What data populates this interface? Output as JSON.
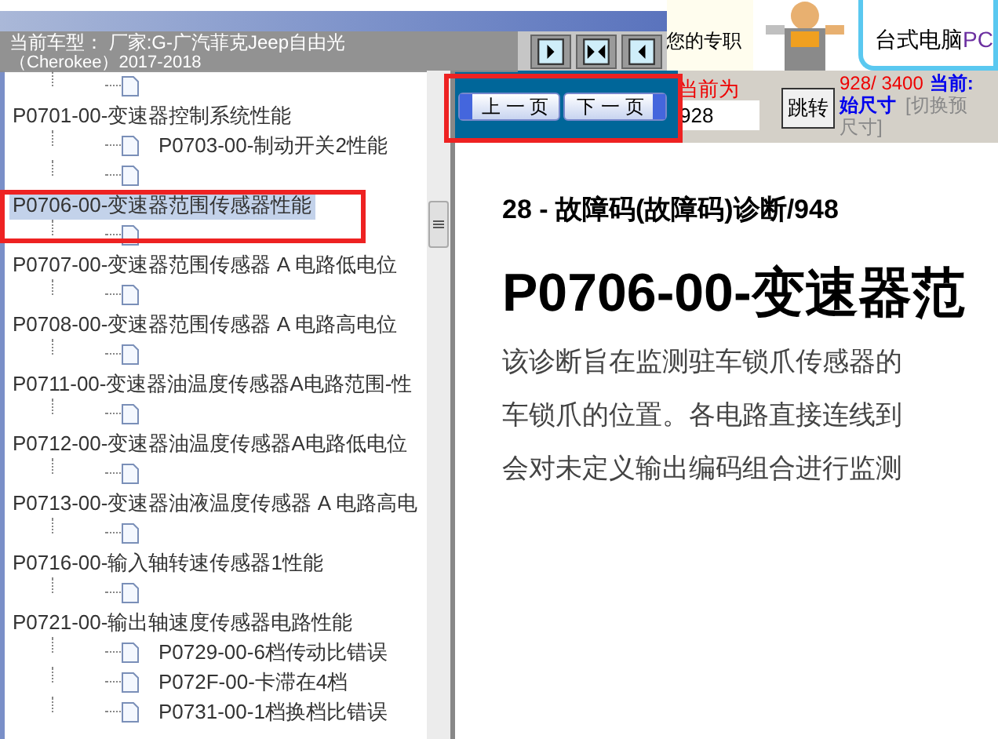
{
  "vehicle_banner": {
    "label": "当前车型：",
    "value": "厂家:G-广汽菲克Jeep自由光",
    "sub": "（Cherokee）2017-2018"
  },
  "view_toggles": [
    {
      "kind": "left"
    },
    {
      "kind": "both"
    },
    {
      "kind": "right"
    }
  ],
  "promo": {
    "text": "您的专职",
    "bubble_text": "台式电脑",
    "bubble_accent": "PC"
  },
  "tree": {
    "items": [
      {
        "children": [
          {
            "kind": "page"
          }
        ]
      },
      {
        "label": "P0701-00-变速器控制系统性能",
        "selected": false,
        "children": [
          {
            "kind": "page",
            "label": "P0703-00-制动开关2性能"
          },
          {
            "kind": "page"
          }
        ]
      },
      {
        "label": "P0706-00-变速器范围传感器性能",
        "selected": true,
        "children": [
          {
            "kind": "page"
          }
        ]
      },
      {
        "label": "P0707-00-变速器范围传感器 A 电路低电位",
        "selected": false,
        "children": [
          {
            "kind": "page"
          }
        ]
      },
      {
        "label": "P0708-00-变速器范围传感器 A 电路高电位",
        "selected": false,
        "children": [
          {
            "kind": "page"
          }
        ]
      },
      {
        "label": "P0711-00-变速器油温度传感器A电路范围-性",
        "selected": false,
        "children": [
          {
            "kind": "page"
          }
        ]
      },
      {
        "label": "P0712-00-变速器油温度传感器A电路低电位",
        "selected": false,
        "children": [
          {
            "kind": "page"
          }
        ]
      },
      {
        "label": "P0713-00-变速器油液温度传感器 A 电路高电",
        "selected": false,
        "children": [
          {
            "kind": "page"
          }
        ]
      },
      {
        "label": "P0716-00-输入轴转速传感器1性能",
        "selected": false,
        "children": [
          {
            "kind": "page"
          }
        ]
      },
      {
        "label": "P0721-00-输出轴速度传感器电路性能",
        "selected": false,
        "children": [
          {
            "kind": "page",
            "label": "P0729-00-6档传动比错误"
          },
          {
            "kind": "page",
            "label": "P072F-00-卡滞在4档"
          },
          {
            "kind": "page",
            "label": "P0731-00-1档换档比错误"
          }
        ]
      }
    ]
  },
  "pager": {
    "prev": "上 一 页",
    "next": "下 一 页",
    "current_label": "当前为",
    "page_value": "928",
    "jump": "跳转",
    "count": "928/ 3400",
    "current_prefix": "当前:",
    "size_label": "始尺寸",
    "switch_a": "[切换预",
    "switch_b": "尺寸]"
  },
  "document": {
    "header": "28 - 故障码(故障码)诊断/948",
    "title": "P0706-00-变速器范",
    "lines": [
      "该诊断旨在监测驻车锁爪传感器的",
      "车锁爪的位置。各电路直接连线到",
      "会对未定义输出编码组合进行监测"
    ]
  }
}
